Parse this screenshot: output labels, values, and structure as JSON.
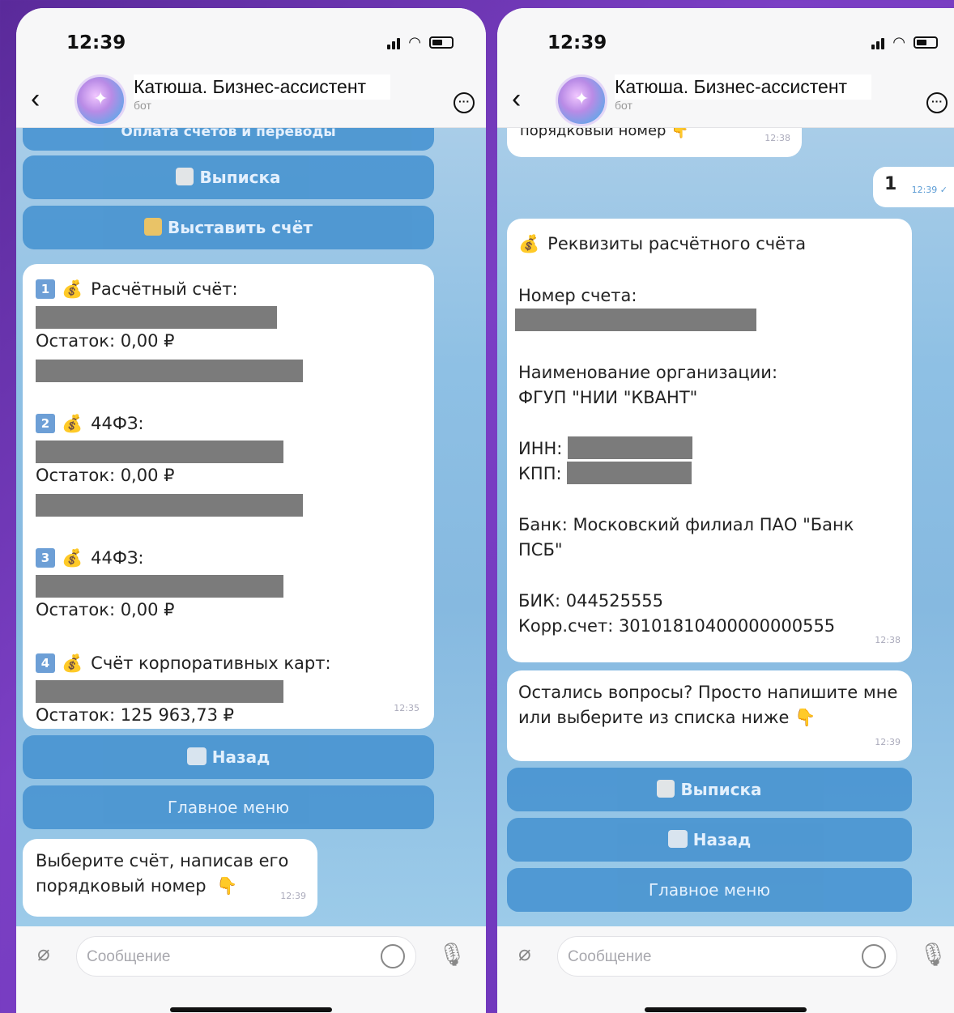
{
  "status": {
    "time": "12:39"
  },
  "header": {
    "chat_name": "Катюша. Бизнес-ассистент",
    "subtitle": "бот"
  },
  "input": {
    "placeholder": "Сообщение"
  },
  "left": {
    "top_button_label": "Оплата счетов и переводы",
    "btn_statement": "Выписка",
    "btn_invoice": "Выставить счёт",
    "accounts": [
      {
        "num": "1",
        "label": "Расчётный счёт:",
        "balance": "Остаток: 0,00 ₽"
      },
      {
        "num": "2",
        "label": "44ФЗ:",
        "balance": "Остаток: 0,00 ₽"
      },
      {
        "num": "3",
        "label": "44ФЗ:",
        "balance": "Остаток: 0,00 ₽"
      },
      {
        "num": "4",
        "label": "Счёт корпоративных карт:",
        "balance": "Остаток: 125 963,73 ₽"
      }
    ],
    "accounts_time": "12:35",
    "btn_back": "Назад",
    "btn_main_menu": "Главное меню",
    "prompt_text": "Выберите счёт, написав его порядковый номер",
    "prompt_time": "12:39"
  },
  "right": {
    "partial_text": "порядковый номер",
    "partial_time": "12:38",
    "sent_text": "1",
    "sent_time": "12:39",
    "requisites_title": "Реквизиты расчётного счёта",
    "account_number_label": "Номер счета:",
    "org_label": "Наименование организации:",
    "org_value": "ФГУП \"НИИ \"КВАНТ\"",
    "inn_label": "ИНН:",
    "kpp_label": "КПП:",
    "bank_text": "Банк: Московский филиал ПАО \"Банк ПСБ\"",
    "bik": "БИК: 044525555",
    "korr": "Корр.счет: 30101810400000000555",
    "requisites_time": "12:38",
    "question_text": "Остались вопросы? Просто напишите мне или выберите из списка ниже",
    "question_time": "12:39",
    "btn_statement": "Выписка",
    "btn_back": "Назад",
    "btn_main_menu": "Главное меню"
  }
}
